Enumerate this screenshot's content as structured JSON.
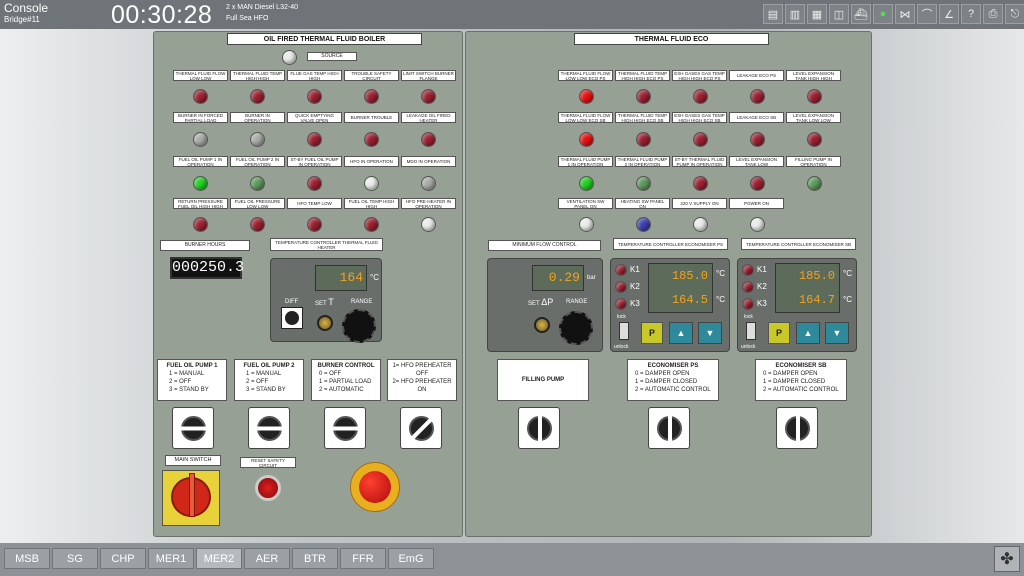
{
  "header": {
    "title": "Console",
    "subtitle": "Bridge#11",
    "clock": "00:30:28",
    "engine": "2 x MAN Diesel L32-40",
    "mode": "Full Sea HFO"
  },
  "toolbar": {
    "icons": [
      "alarm-list-icon",
      "document-icon",
      "save-icon",
      "camera-icon",
      "ship-icon",
      "power-icon",
      "valve-icon",
      "trend-icon",
      "chart-icon",
      "help-icon",
      "print-icon",
      "exit-icon"
    ]
  },
  "left": {
    "title": "OIL FIRED THERMAL FLUID BOILER",
    "source_label": "SOURCE",
    "rows": [
      [
        "THERMAL FLUID FLOW LOW LOW",
        "THERMAL FLUID TEMP HIGH HIGH",
        "FLUE GAS TEMP HIGH HIGH",
        "TROUBLE SAFETY CIRCUIT",
        "LIMIT SWITCH BURNER FLANGE"
      ],
      [
        "BURNER IN FORCED PARTIAL LOAD",
        "BURNER IN OPERATION",
        "QUICK EMPTYING VALVE OPEN",
        "BURNER TROUBLE",
        "LEAKAGE OIL FIRED HEATER"
      ],
      [
        "FUEL OIL PUMP 1 IN OPERATION",
        "FUEL OIL PUMP 2 IN OPERATION",
        "ST-BY FUEL OIL PUMP IN OPERATION",
        "HFO IN OPERATION",
        "MDO IN OPERATION"
      ],
      [
        "RETURN PRESSURE FUEL OIL HIGH HIGH",
        "FUEL OIL PRESSURE LOW LOW",
        "HFO TEMP LOW",
        "FUEL OIL TEMP HIGH HIGH",
        "HFO PRE-HEATER IN OPERATION"
      ]
    ],
    "burner_hours_label": "BURNER HOURS",
    "burner_hours": "000250.3",
    "temp_ctrl_label": "TEMPERATURE CONTROLLER THERMAL FLUID HEATER",
    "temp_value": "164",
    "temp_unit": "°C",
    "diff_label": "DIFF",
    "set_label": "SET",
    "set_sym": "T",
    "range_label": "RANGE",
    "fop1": {
      "h": "FUEL OIL PUMP 1",
      "l1": "1 = MANUAL",
      "l2": "2 = OFF",
      "l3": "3 = STAND BY"
    },
    "fop2": {
      "h": "FUEL OIL PUMP 2",
      "l1": "1 = MANUAL",
      "l2": "2 = OFF",
      "l3": "3 = STAND BY"
    },
    "bc": {
      "h": "BURNER CONTROL",
      "l1": "0 = OFF",
      "l2": "1 = PARTIAL LOAD",
      "l3": "2 = AUTOMATIC"
    },
    "hfo": {
      "l1": "1= HFO PREHEATER",
      "l2": "OFF",
      "l3": "2= HFO PREHEATER",
      "l4": "ON"
    },
    "main_switch": "MAIN SWITCH",
    "reset": "RESET SAFETY CIRCUIT",
    "emergency": "EMERGENCY STOP"
  },
  "right": {
    "title": "THERMAL FLUID ECO",
    "rows": [
      [
        "THERMAL FLUID FLOW LOW LOW ECO PS",
        "THERMAL FLUID TEMP HIGH HIGH ECO PS",
        "EXH GASES GAS TEMP HIGH HIGH ECO PS",
        "LEAKAGE ECO PS",
        "LEVEL EXPANSION TANK HIGH HIGH"
      ],
      [
        "THERMAL FLUID FLOW LOW LOW ECO SB",
        "THERMAL FLUID TEMP HIGH HIGH ECO SB",
        "EXH GASES GAS TEMP HIGH HIGH ECO SB",
        "LEAKAGE ECO SB",
        "LEVEL EXPANSION TANK LOW LOW"
      ],
      [
        "THERMAL FLUID PUMP 1 IN OPERATION",
        "THERMAL FLUID PUMP 2 IN OPERATION",
        "ST-BY THERMAL FLUID PUMP IN OPERATION",
        "LEVEL EXPANSION TANK LOW",
        "FILLING PUMP IN OPERATION"
      ],
      [
        "VENTILATION SW PANEL ON",
        "HEATING SW PANEL ON",
        "220 V SUPPLY ON",
        "POWER ON"
      ]
    ],
    "min_flow_label": "MINIMUM FLOW CONTROL",
    "dp_value": "0.29",
    "dp_unit": "bar",
    "set_label": "SET",
    "dp_sym": "ΔP",
    "range_label": "RANGE",
    "tc_ps_label": "TEMPERATURE CONTROLLER ECONOMISER PS",
    "tc_sb_label": "TEMPERATURE CONTROLLER ECONOMISER SB",
    "ps_v1": "185.0",
    "ps_v2": "164.5",
    "sb_v1": "185.0",
    "sb_v2": "164.7",
    "unit": "°C",
    "k1": "K1",
    "k2": "K2",
    "k3": "K3",
    "lock": "lock",
    "unlock": "unlock",
    "p": "P",
    "filling": "FILLING PUMP",
    "eps": {
      "h": "ECONOMISER PS",
      "l1": "0 = DAMPER OPEN",
      "l2": "1 = DAMPER CLOSED",
      "l3": "2 = AUTOMATIC CONTROL"
    },
    "esb": {
      "h": "ECONOMISER SB",
      "l1": "0 = DAMPER OPEN",
      "l2": "1 = DAMPER CLOSED",
      "l3": "2 = AUTOMATIC CONTROL"
    }
  },
  "tabs": [
    "MSB",
    "SG",
    "CHP",
    "MER1",
    "MER2",
    "AER",
    "BTR",
    "FFR",
    "EmG"
  ],
  "active_tab": "MER2"
}
